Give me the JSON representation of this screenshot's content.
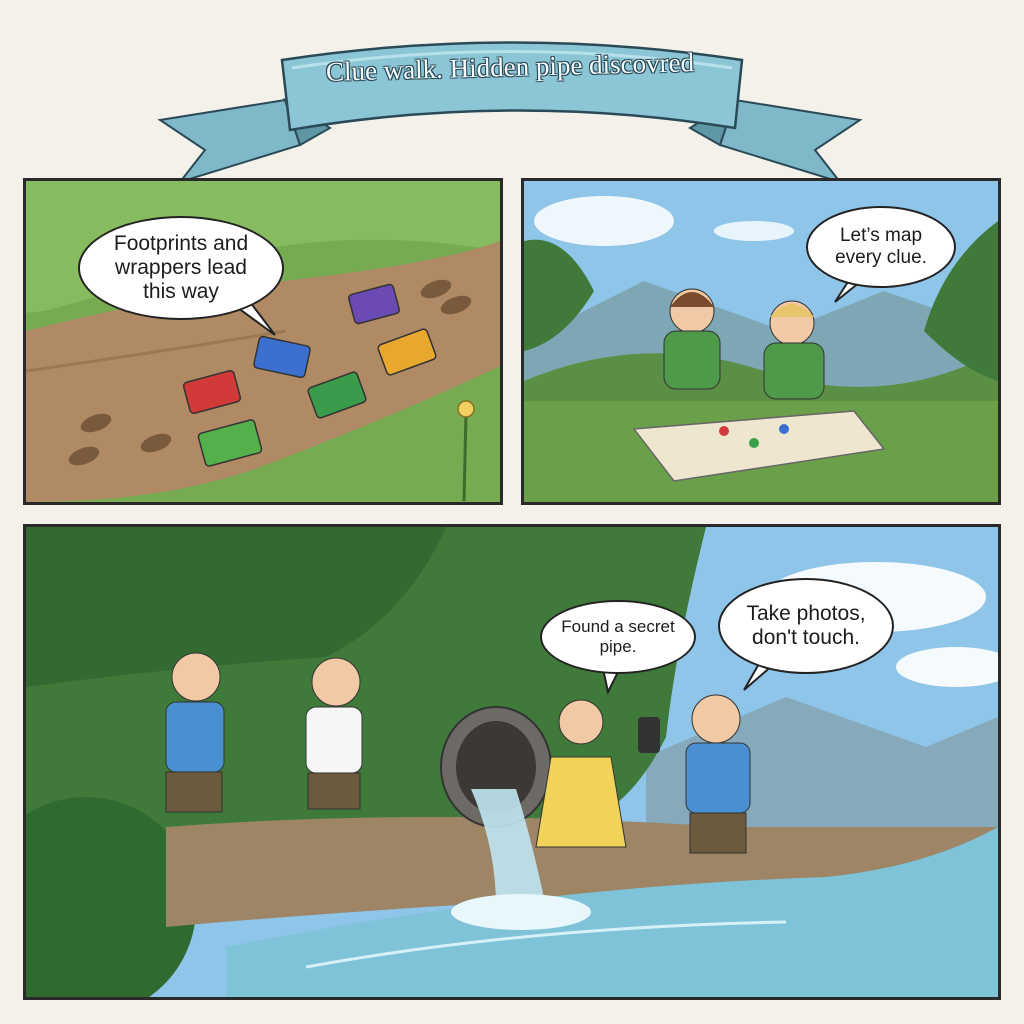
{
  "title": "Clue walk. Hidden pipe discovred",
  "panels": {
    "p1": {
      "speech": "Footprints and wrappers lead this way"
    },
    "p2": {
      "speech": "Let’s map every clue."
    },
    "p3": {
      "speech_left": "Found a secret pipe.",
      "speech_right": "Take photos, don't touch."
    }
  },
  "colors": {
    "ribbon": "#8cc6d6",
    "grass": "#6aa04a",
    "path": "#b08a64",
    "sky": "#8ec5e8",
    "water": "#7ec3d8",
    "foliage": "#3f7a3a"
  }
}
